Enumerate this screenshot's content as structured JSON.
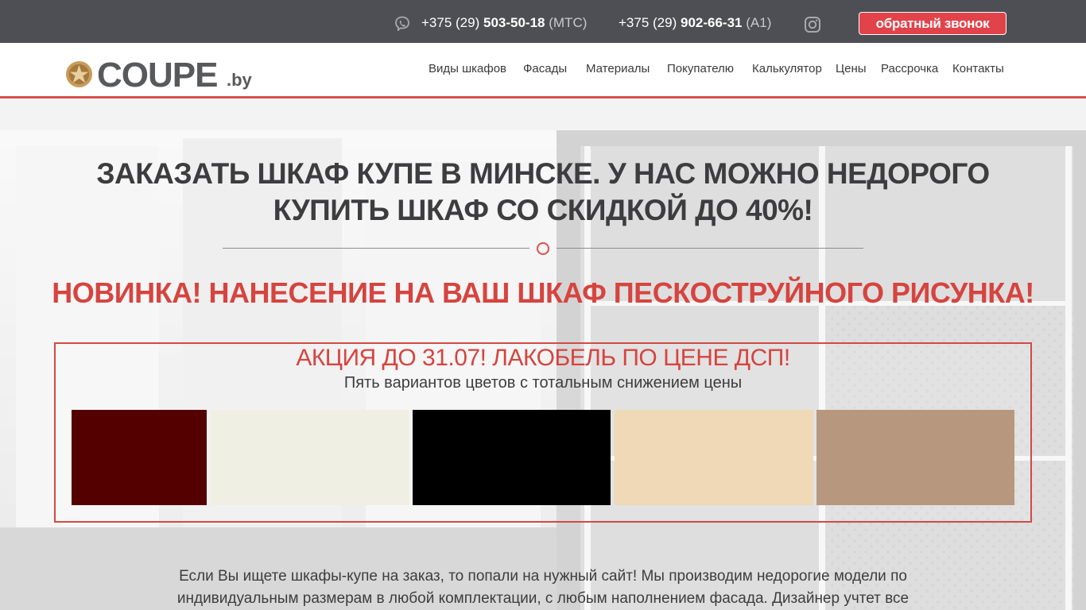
{
  "topbar": {
    "phone1": {
      "prefix": "+375 (29) ",
      "number": "503-50-18",
      "operator": "(МТС)"
    },
    "phone2": {
      "prefix": "+375 (29) ",
      "number": "902-66-31",
      "operator": "(A1)"
    },
    "callback_label": "обратный звонок",
    "icons": [
      "viber-icon",
      "instagram-icon"
    ]
  },
  "header": {
    "logo_text": "COUPE",
    "logo_tld": ".by",
    "nav": [
      "Виды шкафов",
      "Фасады",
      "Материалы",
      "Покупателю",
      "Калькулятор",
      "Цены",
      "Рассрочка",
      "Контакты"
    ]
  },
  "hero": {
    "title": "ЗАКАЗАТЬ ШКАФ КУПЕ В МИНСКЕ. У НАС МОЖНО НЕДОРОГО КУПИТЬ ШКАФ СО СКИДКОЙ ДО 40%!",
    "subtitle": "НОВИНКА! НАНЕСЕНИЕ НА ВАШ ШКАФ ПЕСКОСТРУЙНОГО РИСУНКА!",
    "promo": {
      "title": "АКЦИЯ ДО 31.07! ЛАКОБЕЛЬ ПО ЦЕНЕ ДСП!",
      "subtitle": "Пять вариантов цветов с тотальным снижением цены",
      "swatches": [
        "#550000",
        "#efefe3",
        "#000000",
        "#efd9b6",
        "#b8977f"
      ]
    },
    "intro": "Если Вы ищете шкафы-купе на заказ, то попали на нужный сайт! Мы производим недорогие модели по индивидуальным размерам в любой комплектации, с любым наполнением фасада. Дизайнер учтет все"
  },
  "colors": {
    "topbar_bg": "#4e4f55",
    "accent": "#d6443f",
    "button_bg": "#e2434a",
    "text": "#3d3d3f"
  }
}
